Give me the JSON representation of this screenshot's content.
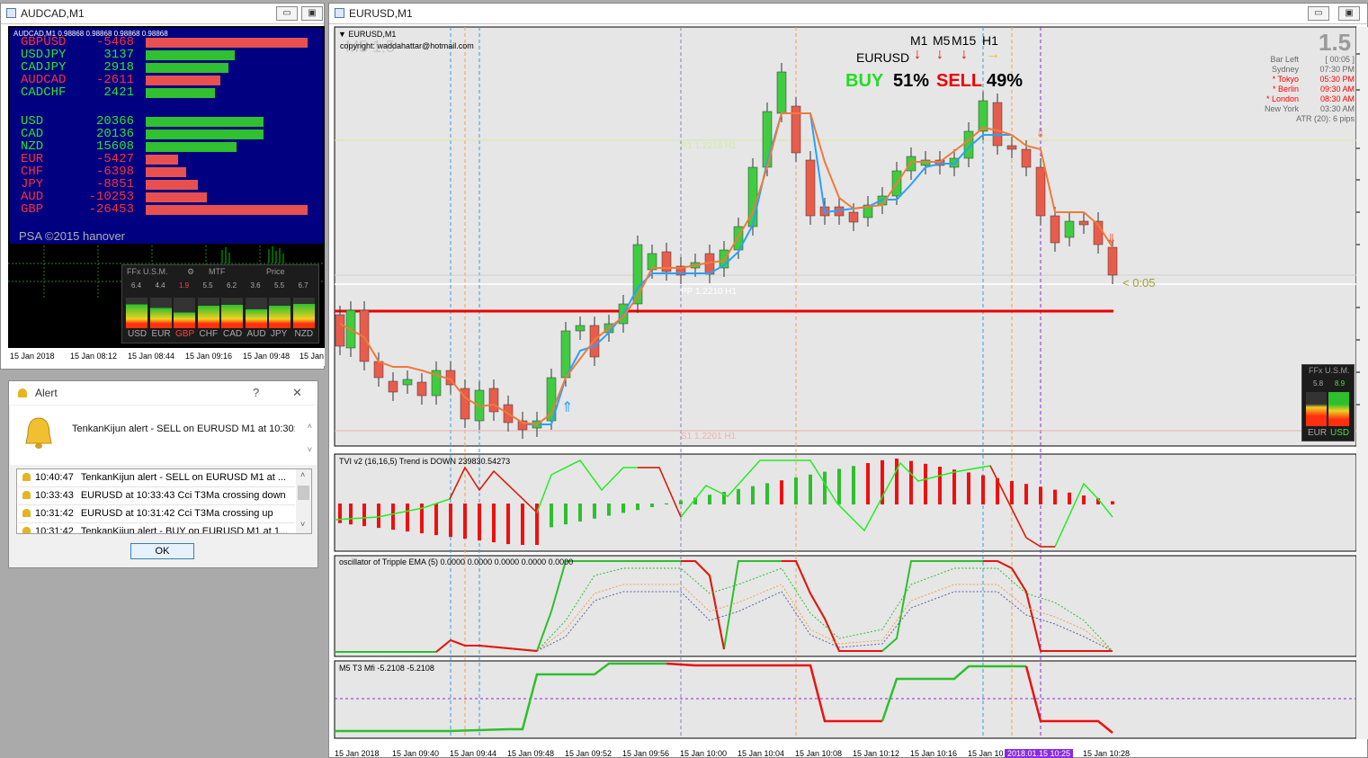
{
  "audcad_window": {
    "title": "AUDCAD,M1",
    "header_line": "AUDCAD,M1  0.98868 0.98868 0.98868 0.98868",
    "pairs": [
      {
        "name": "GBPUSD",
        "value": "-5468",
        "frac": 1.0,
        "color": "#e85050",
        "text_color": "#ff3030"
      },
      {
        "name": "USDJPY",
        "value": "3137",
        "frac": 0.55,
        "color": "#30c030",
        "text_color": "#30e030"
      },
      {
        "name": "CADJPY",
        "value": "2918",
        "frac": 0.51,
        "color": "#30c030",
        "text_color": "#30e030"
      },
      {
        "name": "AUDCAD",
        "value": "-2611",
        "frac": 0.46,
        "color": "#e85050",
        "text_color": "#ff3030"
      },
      {
        "name": "CADCHF",
        "value": "2421",
        "frac": 0.43,
        "color": "#30c030",
        "text_color": "#30e030"
      }
    ],
    "currencies": [
      {
        "name": "USD",
        "value": "20366",
        "frac": 0.73,
        "color": "#30c030",
        "text_color": "#30e030"
      },
      {
        "name": "CAD",
        "value": "20136",
        "frac": 0.73,
        "color": "#30c030",
        "text_color": "#30e030"
      },
      {
        "name": "NZD",
        "value": "15608",
        "frac": 0.56,
        "color": "#30c030",
        "text_color": "#30e030"
      },
      {
        "name": "EUR",
        "value": "-5427",
        "frac": 0.2,
        "color": "#e85050",
        "text_color": "#ff3030"
      },
      {
        "name": "CHF",
        "value": "-6398",
        "frac": 0.25,
        "color": "#e85050",
        "text_color": "#ff3030"
      },
      {
        "name": "JPY",
        "value": "-8851",
        "frac": 0.32,
        "color": "#e85050",
        "text_color": "#ff3030"
      },
      {
        "name": "AUD",
        "value": "-10253",
        "frac": 0.38,
        "color": "#e85050",
        "text_color": "#ff3030"
      },
      {
        "name": "GBP",
        "value": "-26453",
        "frac": 1.0,
        "color": "#e85050",
        "text_color": "#ff3030"
      }
    ],
    "footer": "PSA ©2015 hanover",
    "ffx": {
      "title": "FFx U.S.M.",
      "mtf": "MTF",
      "price": "Price",
      "values": [
        "6.4",
        "4.4",
        "1.9",
        "5.5",
        "6.2",
        "3.6",
        "5.5",
        "6.7"
      ],
      "currencies": [
        "USD",
        "EUR",
        "GBP",
        "CHF",
        "CAD",
        "AUD",
        "JPY",
        "NZD"
      ],
      "highlight": "GBP"
    },
    "time_labels": [
      "15 Jan 2018",
      "15 Jan 08:12",
      "15 Jan 08:44",
      "15 Jan 09:16",
      "15 Jan 09:48",
      "15 Jan"
    ]
  },
  "alert": {
    "title": "Alert",
    "help": "?",
    "close": "✕",
    "message": "TenkanKijun alert - SELL on EURUSD M1 at 10:30:0",
    "rows": [
      {
        "time": "10:40:47",
        "text": "TenkanKijun alert - SELL on EURUSD M1 at ..."
      },
      {
        "time": "10:33:43",
        "text": "EURUSD at 10:33:43 Cci T3Ma crossing down"
      },
      {
        "time": "10:31:42",
        "text": "EURUSD at 10:31:42 Cci T3Ma crossing up"
      },
      {
        "time": "10:31:42",
        "text": "TenkanKijun alert - BUY on EURUSD M1 at 1..."
      }
    ],
    "ok": "OK"
  },
  "eurusd_window": {
    "title": "EURUSD,M1",
    "chart_label": "EURUSD,M1",
    "watermark": "M5  1.5",
    "copyright": "copyright: waddahattar@hotmail.com",
    "tf_labels": [
      "M1",
      "M5",
      "M15",
      "H1"
    ],
    "symbol": "EURUSD",
    "buy_label": "BUY",
    "buy_pct": "51%",
    "sell_label": "SELL",
    "sell_pct": "49%",
    "big_value": "1.5",
    "bar_left_label": "Bar Left",
    "bar_left_value": "[ 00:05 ]",
    "sessions": [
      {
        "name": "Sydney",
        "time": "07:30 PM",
        "color": "#666666"
      },
      {
        "name": "* Tokyo",
        "time": "05:30 PM",
        "color": "#ff0000"
      },
      {
        "name": "* Berlin",
        "time": "09:30 AM",
        "color": "#ff0000"
      },
      {
        "name": "* London",
        "time": "08:30 AM",
        "color": "#ff0000"
      },
      {
        "name": "New York",
        "time": "03:30 AM",
        "color": "#666666"
      }
    ],
    "atr": "ATR (20): 6 pips",
    "countdown": "< 0:05",
    "level_r1": "R1 1.2219 H1",
    "level_pp": "PP 1.2210 H1",
    "level_s1": "S1 1.2201 H1",
    "ffx_small": {
      "title": "FFx U.S.M.",
      "values": [
        "5.8",
        "8.9"
      ],
      "currencies": [
        "EUR",
        "USD"
      ]
    },
    "tvi_label": "TVI v2 (16,16,5) Trend is DOWN 239830.54273",
    "tema_label": "oscillator of Tripple EMA (5) 0.0000 0.0000 0.0000 0.0000 0.0000",
    "mfi_label": "M5  T3 Mfi  -5.2108 -5.2108",
    "time_labels": [
      "15 Jan 2018",
      "15 Jan 09:40",
      "15 Jan 09:44",
      "15 Jan 09:48",
      "15 Jan 09:52",
      "15 Jan 09:56",
      "15 Jan 10:00",
      "15 Jan 10:04",
      "15 Jan 10:08",
      "15 Jan 10:12",
      "15 Jan 10:16",
      "15 Jan 10",
      "15 Jan 10:28"
    ],
    "cursor_time": "2018.01.15 10:25"
  }
}
